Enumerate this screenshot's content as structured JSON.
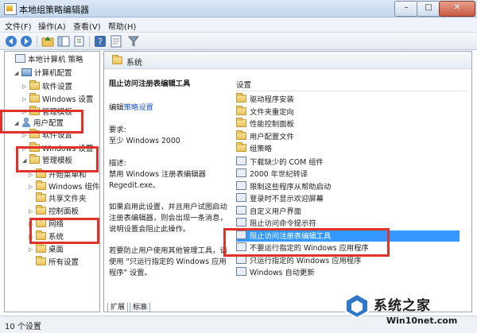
{
  "window": {
    "title": "本地组策略编辑器",
    "min": "–",
    "max": "□",
    "close": "✕"
  },
  "menu": [
    "文件(F)",
    "操作(A)",
    "查看(V)",
    "帮助(H)"
  ],
  "toolbar_icons": [
    "back-arrow-icon",
    "forward-arrow-icon",
    "folder-up-icon",
    "show-hide-tree-icon",
    "export-icon",
    "help-icon",
    "properties-icon",
    "filter-icon"
  ],
  "tree": [
    {
      "label": "本地计算机 策略",
      "level": 0,
      "icon": "policy",
      "arrow": ""
    },
    {
      "label": "计算机配置",
      "level": 1,
      "icon": "pc",
      "arrow": "◢"
    },
    {
      "label": "软件设置",
      "level": 2,
      "icon": "folder",
      "arrow": "▷"
    },
    {
      "label": "Windows 设置",
      "level": 2,
      "icon": "folder",
      "arrow": "▷"
    },
    {
      "label": "管理模板",
      "level": 2,
      "icon": "folder",
      "arrow": "▷"
    },
    {
      "label": "用户配置",
      "level": 1,
      "icon": "user",
      "arrow": "◢"
    },
    {
      "label": "软件设置",
      "level": 2,
      "icon": "folder",
      "arrow": "▷"
    },
    {
      "label": "Windows 设置",
      "level": 2,
      "icon": "folder",
      "arrow": "▷"
    },
    {
      "label": "管理模板",
      "level": 2,
      "icon": "folder",
      "arrow": "◢"
    },
    {
      "label": "开始菜单和",
      "level": 3,
      "icon": "folder",
      "arrow": "▷"
    },
    {
      "label": "Windows 组件",
      "level": 3,
      "icon": "folder",
      "arrow": "▷"
    },
    {
      "label": "共享文件夹",
      "level": 3,
      "icon": "folder",
      "arrow": ""
    },
    {
      "label": "控制面板",
      "level": 3,
      "icon": "folder",
      "arrow": "▷"
    },
    {
      "label": "网络",
      "level": 3,
      "icon": "folder",
      "arrow": "▷"
    },
    {
      "label": "系统",
      "level": 3,
      "icon": "folder",
      "arrow": "▷"
    },
    {
      "label": "桌面",
      "level": 3,
      "icon": "folder",
      "arrow": "▷"
    },
    {
      "label": "所有设置",
      "level": 3,
      "icon": "folder",
      "arrow": ""
    }
  ],
  "right": {
    "header": "系统",
    "description": {
      "title": "阻止访问注册表编辑工具",
      "edit_prefix": "编辑",
      "edit_link": "策略设置",
      "req_label": "要求:",
      "req_value": "至少 Windows 2000",
      "desc_label": "描述:",
      "desc_lines": [
        "禁用 Windows 注册表编辑器",
        "Regedit.exe。"
      ],
      "para2": [
        "如果启用此设置，并且用户试图启动",
        "注册表编辑器，则会出现一条消息，",
        "说明设置会阻止此操作。"
      ],
      "para3": [
        "若要防止用户使用其他管理工具，请",
        "使用 \"只运行指定的 Windows 应用",
        "程序\" 设置。"
      ]
    },
    "list_header": "设置",
    "list": [
      {
        "label": "驱动程序安装",
        "icon": "folder"
      },
      {
        "label": "文件夹重定向",
        "icon": "folder"
      },
      {
        "label": "性能控制面板",
        "icon": "folder"
      },
      {
        "label": "用户配置文件",
        "icon": "folder"
      },
      {
        "label": "组策略",
        "icon": "folder"
      },
      {
        "label": "下载缺少的 COM 组件",
        "icon": "policy"
      },
      {
        "label": "2000 年世纪转译",
        "icon": "policy"
      },
      {
        "label": "限制这些程序从帮助启动",
        "icon": "policy"
      },
      {
        "label": "登录时不显示欢迎屏幕",
        "icon": "policy"
      },
      {
        "label": "自定义用户界面",
        "icon": "policy"
      },
      {
        "label": "阻止访问命令提示符",
        "icon": "policy"
      },
      {
        "label": "阻止访问注册表编辑工具",
        "icon": "policy",
        "selected": true
      },
      {
        "label": "不要运行指定的 Windows 应用程序",
        "icon": "policy"
      },
      {
        "label": "只运行指定的 Windows 应用程序",
        "icon": "policy"
      },
      {
        "label": "Windows 自动更新",
        "icon": "policy"
      }
    ],
    "tabs": [
      "扩展",
      "标准"
    ]
  },
  "status": "10 个设置",
  "watermark": {
    "text": "系统之家",
    "url": "Win10net.com"
  },
  "colors": {
    "highlight": "#e0312b",
    "selection": "#3399ff",
    "link": "#1a55c9"
  }
}
